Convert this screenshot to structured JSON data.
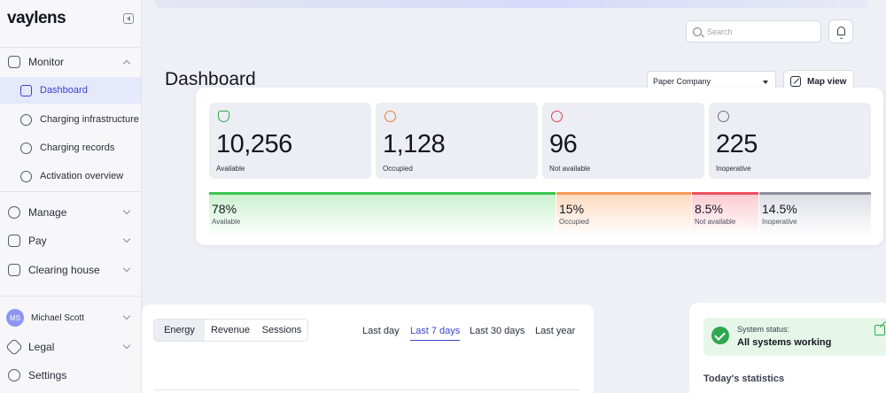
{
  "app": {
    "logo": "vaylens"
  },
  "sidebar": {
    "groups": [
      {
        "label": "Monitor",
        "icon": "activity-icon",
        "expanded": true
      },
      {
        "label": "Manage",
        "icon": "manage-icon"
      },
      {
        "label": "Pay",
        "icon": "dollar-icon"
      },
      {
        "label": "Clearing house",
        "icon": "clearing-house-icon"
      }
    ],
    "monitor_items": [
      {
        "label": "Dashboard",
        "active": true
      },
      {
        "label": "Charging infrastructure"
      },
      {
        "label": "Charging records"
      },
      {
        "label": "Activation overview"
      }
    ],
    "user": {
      "initials": "MS",
      "name": "Michael Scott"
    },
    "footer": [
      {
        "label": "Legal"
      },
      {
        "label": "Settings"
      }
    ]
  },
  "header": {
    "search_placeholder": "Search",
    "title": "Dashboard",
    "company": "Paper Company",
    "map_view_label": "Map view"
  },
  "stats": [
    {
      "value": "10,256",
      "label": "Available",
      "color": "#2fa84f"
    },
    {
      "value": "1,128",
      "label": "Occupied",
      "color": "#f07c2a"
    },
    {
      "value": "96",
      "label": "Not available",
      "color": "#e5364a"
    },
    {
      "value": "225",
      "label": "Inoperative",
      "color": "#6b6f7c"
    }
  ],
  "distribution": [
    {
      "pct": "78%",
      "label": "Available",
      "color": "#3cc450",
      "fraction": 0.78
    },
    {
      "pct": "15%",
      "label": "Occupied",
      "color": "#f59a5a",
      "fraction": 0.15
    },
    {
      "pct": "8.5%",
      "label": "Not available",
      "color": "#ec4f62",
      "fraction": 0.085
    },
    {
      "pct": "14.5%",
      "label": "Inoperative",
      "color": "#8e90a0",
      "fraction": 0.145
    }
  ],
  "chart": {
    "metric_tabs": [
      "Energy",
      "Revenue",
      "Sessions"
    ],
    "active_metric": "Energy",
    "ranges": [
      "Last day",
      "Last 7 days",
      "Last 30 days",
      "Last year"
    ],
    "active_range": "Last 7 days"
  },
  "status": {
    "label": "System status:",
    "value": "All systems working",
    "section_title": "Today's statistics"
  }
}
